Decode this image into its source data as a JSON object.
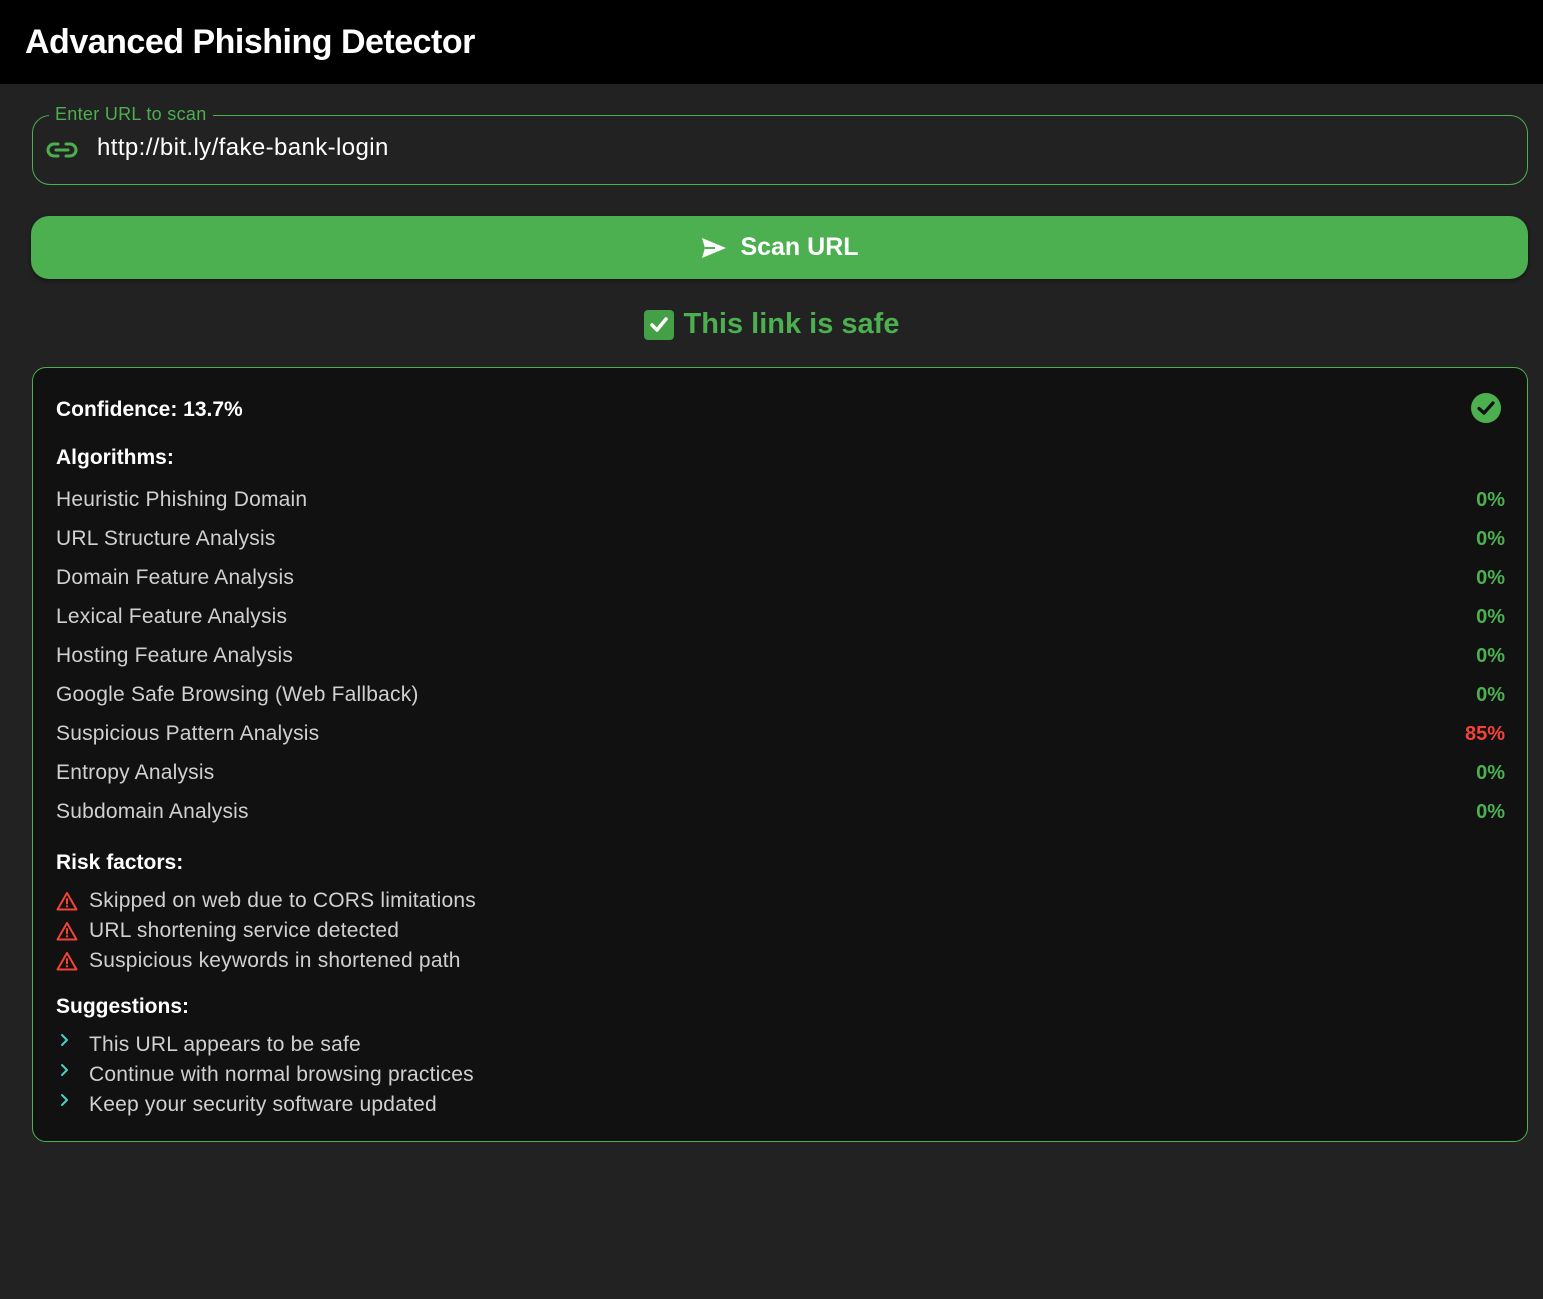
{
  "app": {
    "title": "Advanced Phishing Detector"
  },
  "url_input": {
    "label": "Enter URL to scan",
    "value": "http://bit.ly/fake-bank-login",
    "icon": "link-icon"
  },
  "scan_button": {
    "label": "Scan URL",
    "icon": "send-icon"
  },
  "status": {
    "text": "This link is safe",
    "icon": "check-emoji-icon"
  },
  "result": {
    "confidence_text": "Confidence: 13.7%",
    "safe_icon": "check-circle-icon",
    "algorithms_title": "Algorithms:",
    "algorithms": [
      {
        "name": "Heuristic Phishing Domain",
        "score": "0%",
        "level": "safe"
      },
      {
        "name": "URL Structure Analysis",
        "score": "0%",
        "level": "safe"
      },
      {
        "name": "Domain Feature Analysis",
        "score": "0%",
        "level": "safe"
      },
      {
        "name": "Lexical Feature Analysis",
        "score": "0%",
        "level": "safe"
      },
      {
        "name": "Hosting Feature Analysis",
        "score": "0%",
        "level": "safe"
      },
      {
        "name": "Google Safe Browsing (Web Fallback)",
        "score": "0%",
        "level": "safe"
      },
      {
        "name": "Suspicious Pattern Analysis",
        "score": "85%",
        "level": "danger"
      },
      {
        "name": "Entropy Analysis",
        "score": "0%",
        "level": "safe"
      },
      {
        "name": "Subdomain Analysis",
        "score": "0%",
        "level": "safe"
      }
    ],
    "risk_title": "Risk factors:",
    "risk_factors": [
      "Skipped on web due to CORS limitations",
      "URL shortening service detected",
      "Suspicious keywords in shortened path"
    ],
    "suggestions_title": "Suggestions:",
    "suggestions": [
      "This URL appears to be safe",
      "Continue with normal browsing practices",
      "Keep your security software updated"
    ]
  },
  "colors": {
    "accent": "#4caf50",
    "danger": "#f44336",
    "chevron": "#4dd0c4",
    "background": "#222222",
    "card": "#111111",
    "appbar": "#000000"
  }
}
